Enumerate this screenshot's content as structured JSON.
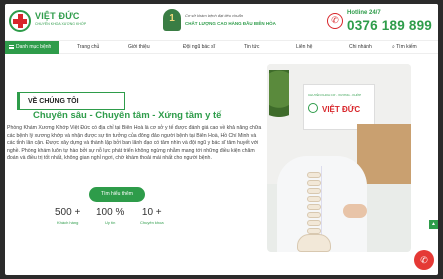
{
  "brand": {
    "name": "VIỆT ĐỨC",
    "subtitle": "CHUYÊN KHOA XƯƠNG KHỚP"
  },
  "award": {
    "badge": "1",
    "line1": "Cơ sở khám bệnh đạt tiêu chuẩn",
    "line2": "CHẤT LƯỢNG CAO HÀNG ĐẦU BIÊN HÒA"
  },
  "hotline": {
    "label": "Hotline 24/7",
    "number": "0376 189 899"
  },
  "nav": {
    "category": "Danh mục bệnh",
    "items": [
      "Trang chủ",
      "Giới thiệu",
      "Đội ngũ bác sĩ",
      "Tin tức",
      "Liên hệ",
      "Chi nhánh"
    ],
    "search": "Tìm kiếm"
  },
  "about": {
    "heading": "VỀ CHÚNG TÔI",
    "slogan": "Chuyên sâu - Chuyên tâm - Xứng tầm y tế",
    "description": "Phòng Khám Xương Khớp Việt Đức có địa chỉ tại Biên Hoà là cơ sở y tế được đánh giá cao về khả năng chữa các bệnh lý xương khớp và nhận được sự tin tưởng của đông đảo người bệnh tại Biên Hoà, Hồ Chí Minh và các tỉnh lân cận. Được xây dựng và thành lập bởi ban lãnh đạo có tâm nhìn và đội ngũ y bác sĩ tâm huyết với nghề. Phòng khám luôn tự hào bởi sự nỗ lực phát triển không ngừng nhằm mang tới những điều kiện chăm đoán và điều trị tốt nhất, không gian nghỉ ngơi, chờ khám thoải mái nhất cho người bệnh.",
    "cta": "Tìm hiểu thêm"
  },
  "stats": [
    {
      "value": "500 +",
      "label": "Khách hàng"
    },
    {
      "value": "100 %",
      "label": "Uy tín"
    },
    {
      "value": "10 +",
      "label": "Chuyên khoa"
    }
  ],
  "photo": {
    "sign_top": "CHUYÊN KHOA CƠ - XƯƠNG - KHỚP",
    "sign_brand": "VIỆT ĐỨC"
  },
  "colors": {
    "brand_green": "#2e9c4a",
    "accent_red": "#d8262b",
    "fab_red": "#e53935"
  },
  "icons": {
    "phone": "phone-icon",
    "search": "search-icon",
    "menu": "menu-icon",
    "award": "award-icon"
  }
}
